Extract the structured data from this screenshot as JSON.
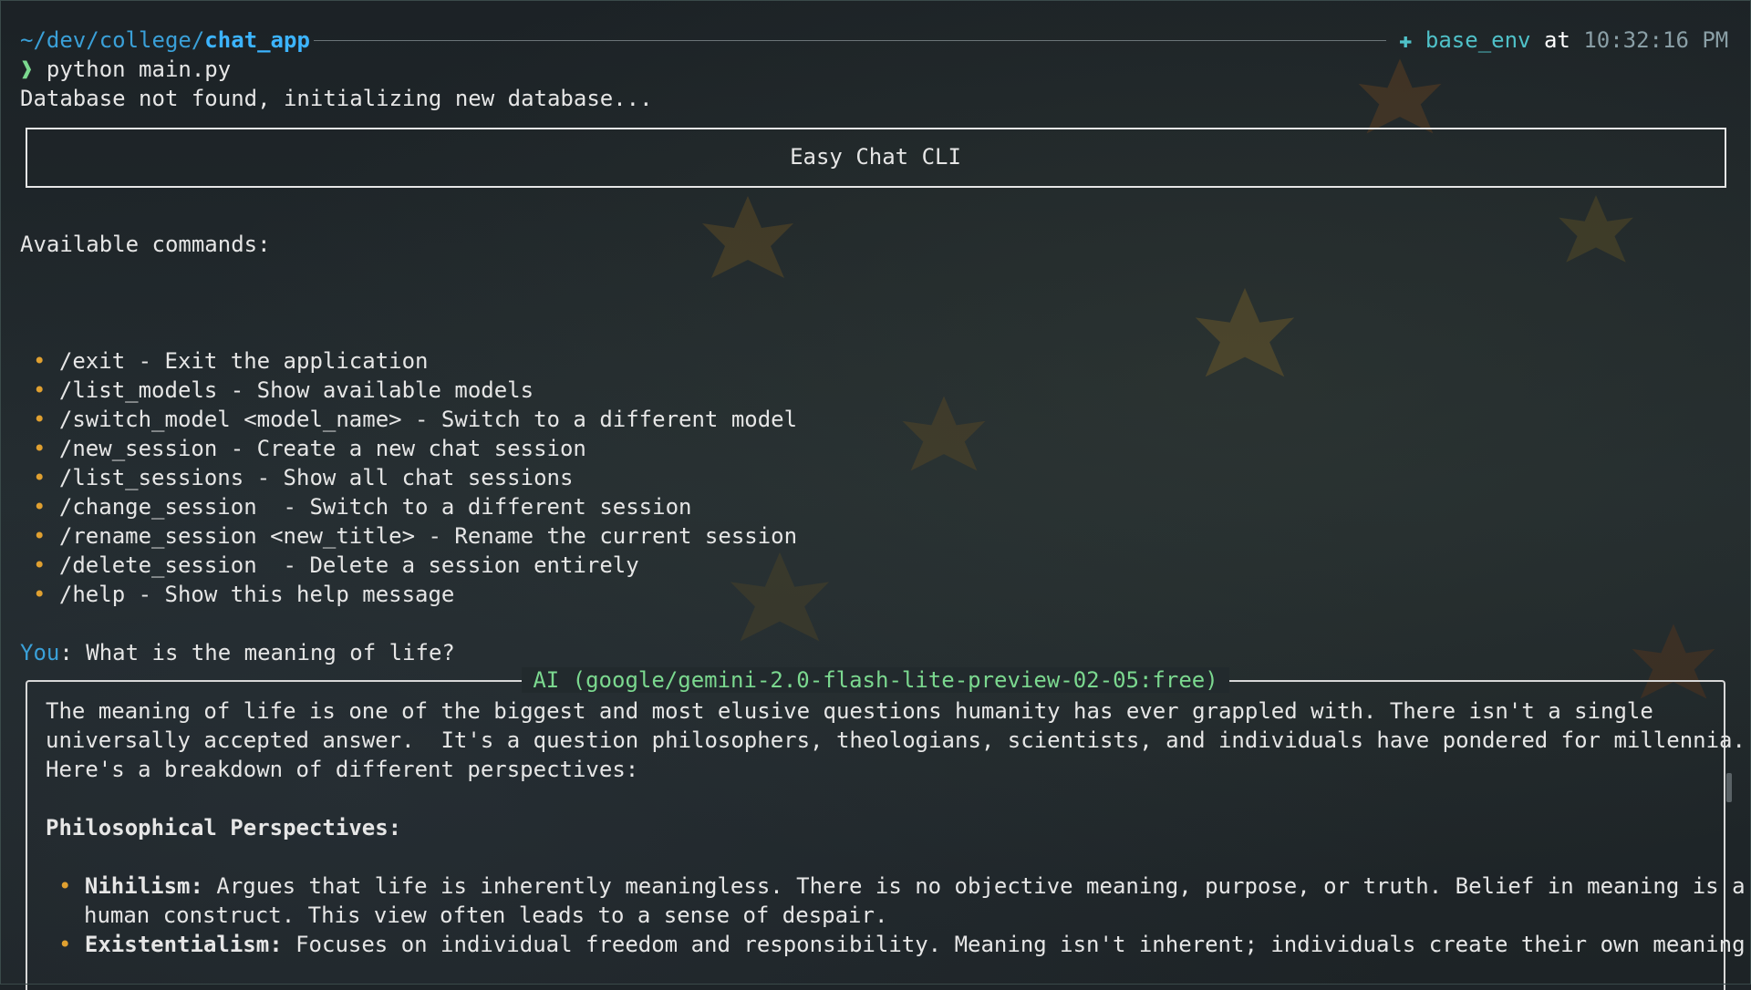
{
  "prompt": {
    "path_prefix": "~/dev/college/",
    "path_dir": "chat_app",
    "env_icon": "python-env-icon",
    "env_name": "base_env",
    "at_word": "at",
    "time": "10:32:16 PM",
    "arrow": "❱",
    "command": "python main.py"
  },
  "init_message": "Database not found, initializing new database...",
  "banner_title": "Easy Chat CLI",
  "commands_heading": "Available commands:",
  "commands": [
    "/exit - Exit the application",
    "/list_models - Show available models",
    "/switch_model <model_name> - Switch to a different model",
    "/new_session - Create a new chat session",
    "/list_sessions - Show all chat sessions",
    "/change_session  - Switch to a different session",
    "/rename_session <new_title> - Rename the current session",
    "/delete_session  - Delete a session entirely",
    "/help - Show this help message"
  ],
  "user_prompt": {
    "label": "You",
    "separator": ":",
    "text": " What is the meaning of life?"
  },
  "ai_panel": {
    "title": "AI (google/gemini-2.0-flash-lite-preview-02-05:free)",
    "lines": [
      "The meaning of life is one of the biggest and most elusive questions humanity has ever grappled with. There isn't a single",
      "universally accepted answer.  It's a question philosophers, theologians, scientists, and individuals have pondered for millennia.",
      "Here's a breakdown of different perspectives:"
    ],
    "section_heading": "Philosophical Perspectives:",
    "bullets": [
      {
        "term": "Nihilism:",
        "text": " Argues that life is inherently meaningless. There is no objective meaning, purpose, or truth. Belief in meaning is a",
        "cont": "human construct. This view often leads to a sense of despair."
      },
      {
        "term": "Existentialism:",
        "text": " Focuses on individual freedom and responsibility. Meaning isn't inherent; individuals create their own meaning",
        "cont": ""
      }
    ]
  },
  "colors": {
    "path": "#3cb4ff",
    "env": "#4fc1c8",
    "bullet": "#e0a030",
    "ai_title": "#7bd88f",
    "you_label": "#3aa0d8"
  }
}
